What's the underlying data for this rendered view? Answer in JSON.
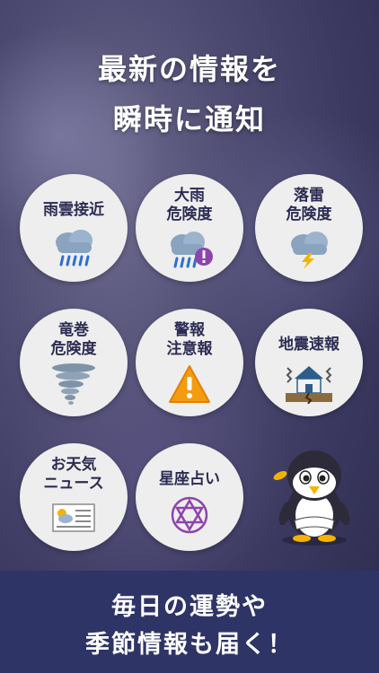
{
  "headline": {
    "line1": "最新の情報を",
    "line2": "瞬時に通知"
  },
  "tiles": [
    {
      "line1": "雨雲接近",
      "line2": "",
      "icon": "rain-cloud-icon"
    },
    {
      "line1": "大雨",
      "line2": "危険度",
      "icon": "heavy-rain-warning-icon"
    },
    {
      "line1": "落雷",
      "line2": "危険度",
      "icon": "thunder-cloud-icon"
    },
    {
      "line1": "竜巻",
      "line2": "危険度",
      "icon": "tornado-icon"
    },
    {
      "line1": "警報",
      "line2": "注意報",
      "icon": "warning-triangle-icon"
    },
    {
      "line1": "地震速報",
      "line2": "",
      "icon": "earthquake-house-icon"
    },
    {
      "line1": "お天気",
      "line2": "ニュース",
      "icon": "weather-news-icon"
    },
    {
      "line1": "星座占い",
      "line2": "",
      "icon": "hexagram-star-icon"
    }
  ],
  "footer": {
    "line1": "毎日の運勢や",
    "line2": "季節情報も届く！"
  },
  "colors": {
    "label": "#2c2c54",
    "footer_bg": "#2f3466",
    "tile_bg": "#eeeeee",
    "accent_purple": "#8e44ad",
    "warning_orange": "#f39c12"
  }
}
